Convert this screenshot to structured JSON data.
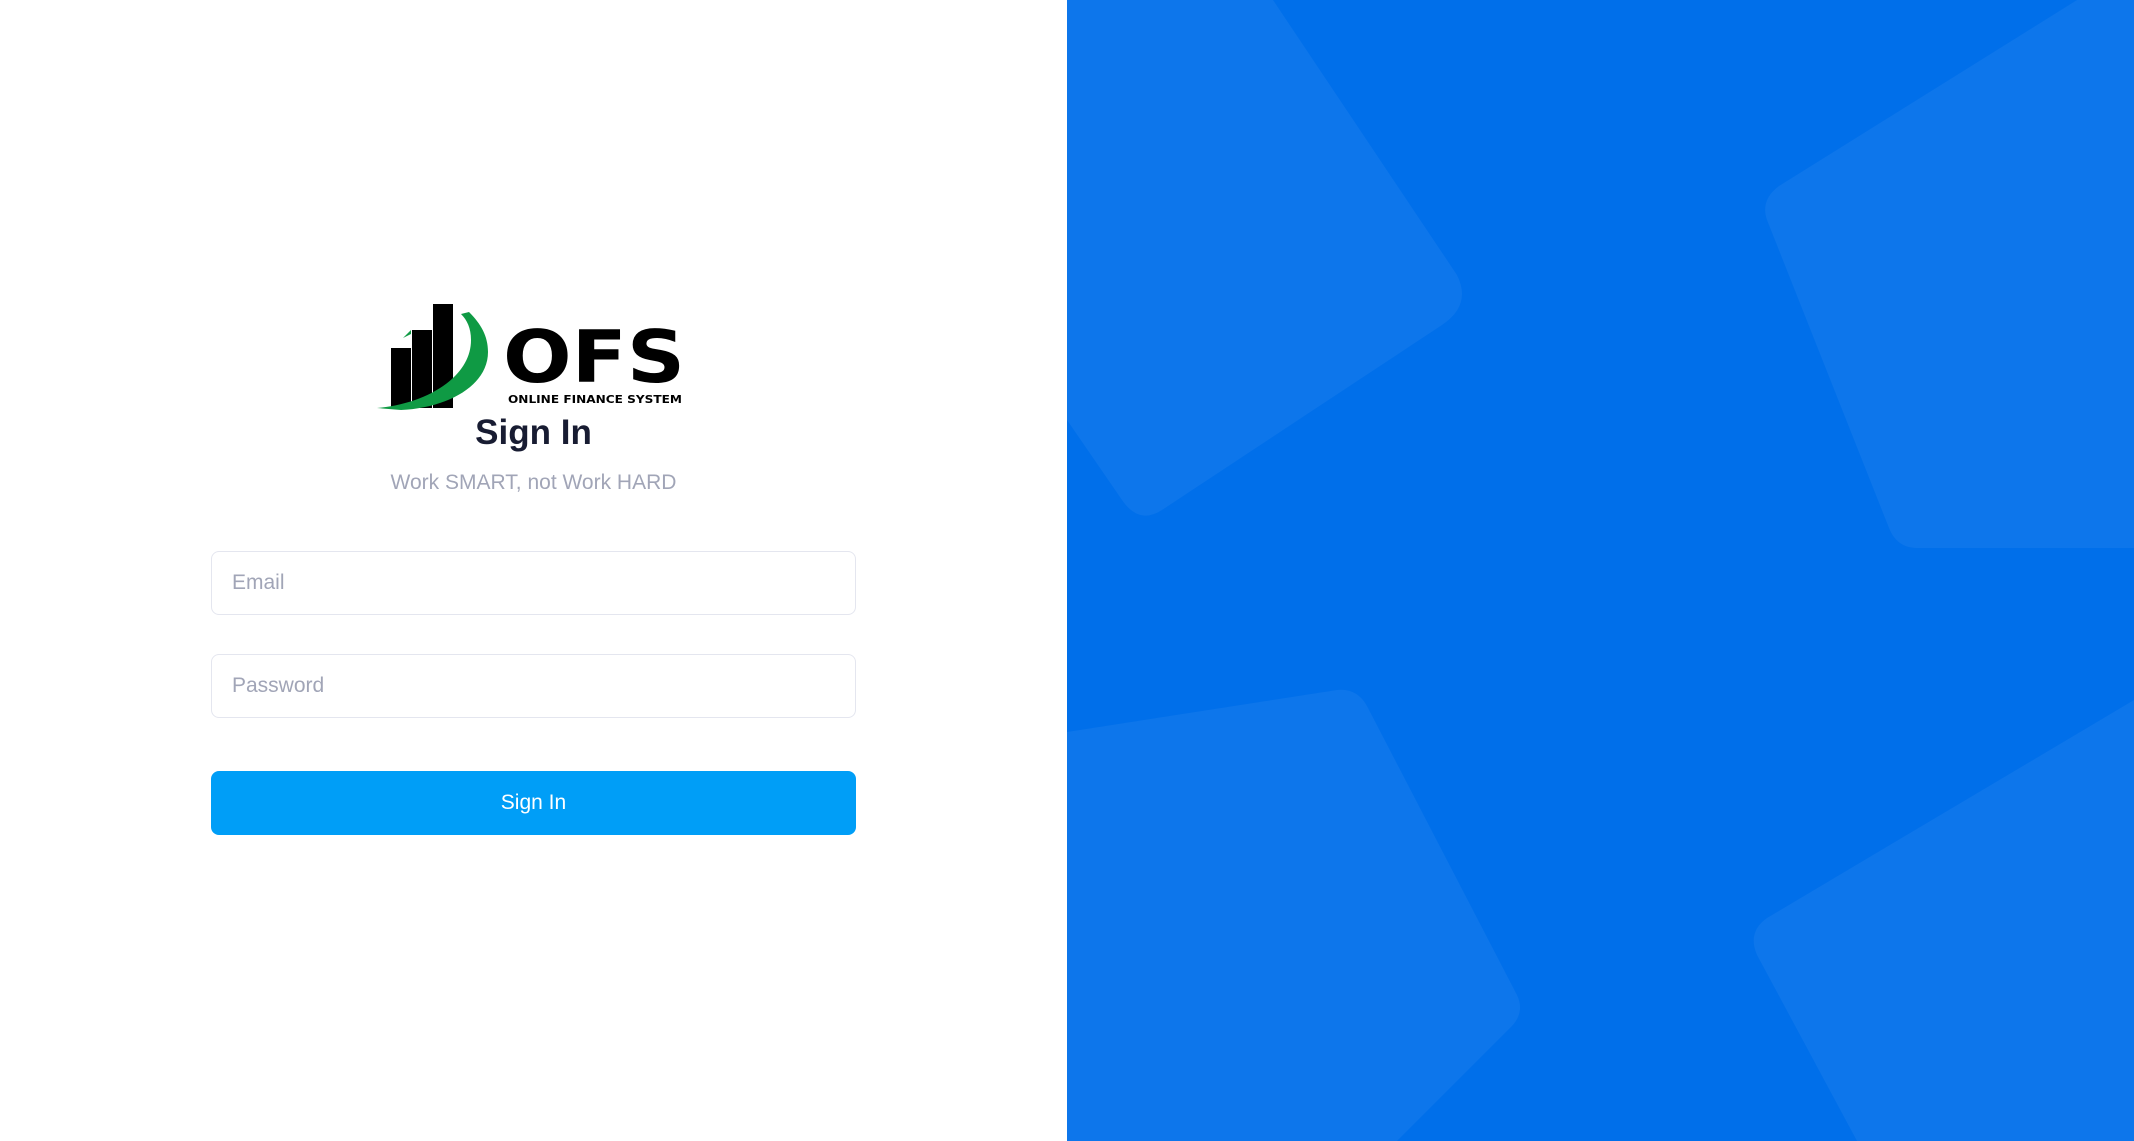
{
  "logo": {
    "mark": "OFS",
    "tagline": "ONLINE FINANCE SYSTEM",
    "colors": {
      "bars": "#000000",
      "swoosh": "#0f9a44",
      "text": "#000000"
    }
  },
  "login": {
    "title": "Sign In",
    "subtitle": "Work SMART, not Work HARD",
    "email_placeholder": "Email",
    "email_value": "",
    "password_placeholder": "Password",
    "password_value": "",
    "submit_label": "Sign In"
  },
  "colors": {
    "page_left_bg": "#ffffff",
    "page_right_bg": "#006fea",
    "button_bg": "#009ef7",
    "title": "#181c32",
    "muted_text": "#a1a5b7",
    "input_border": "#e4e6ef"
  }
}
